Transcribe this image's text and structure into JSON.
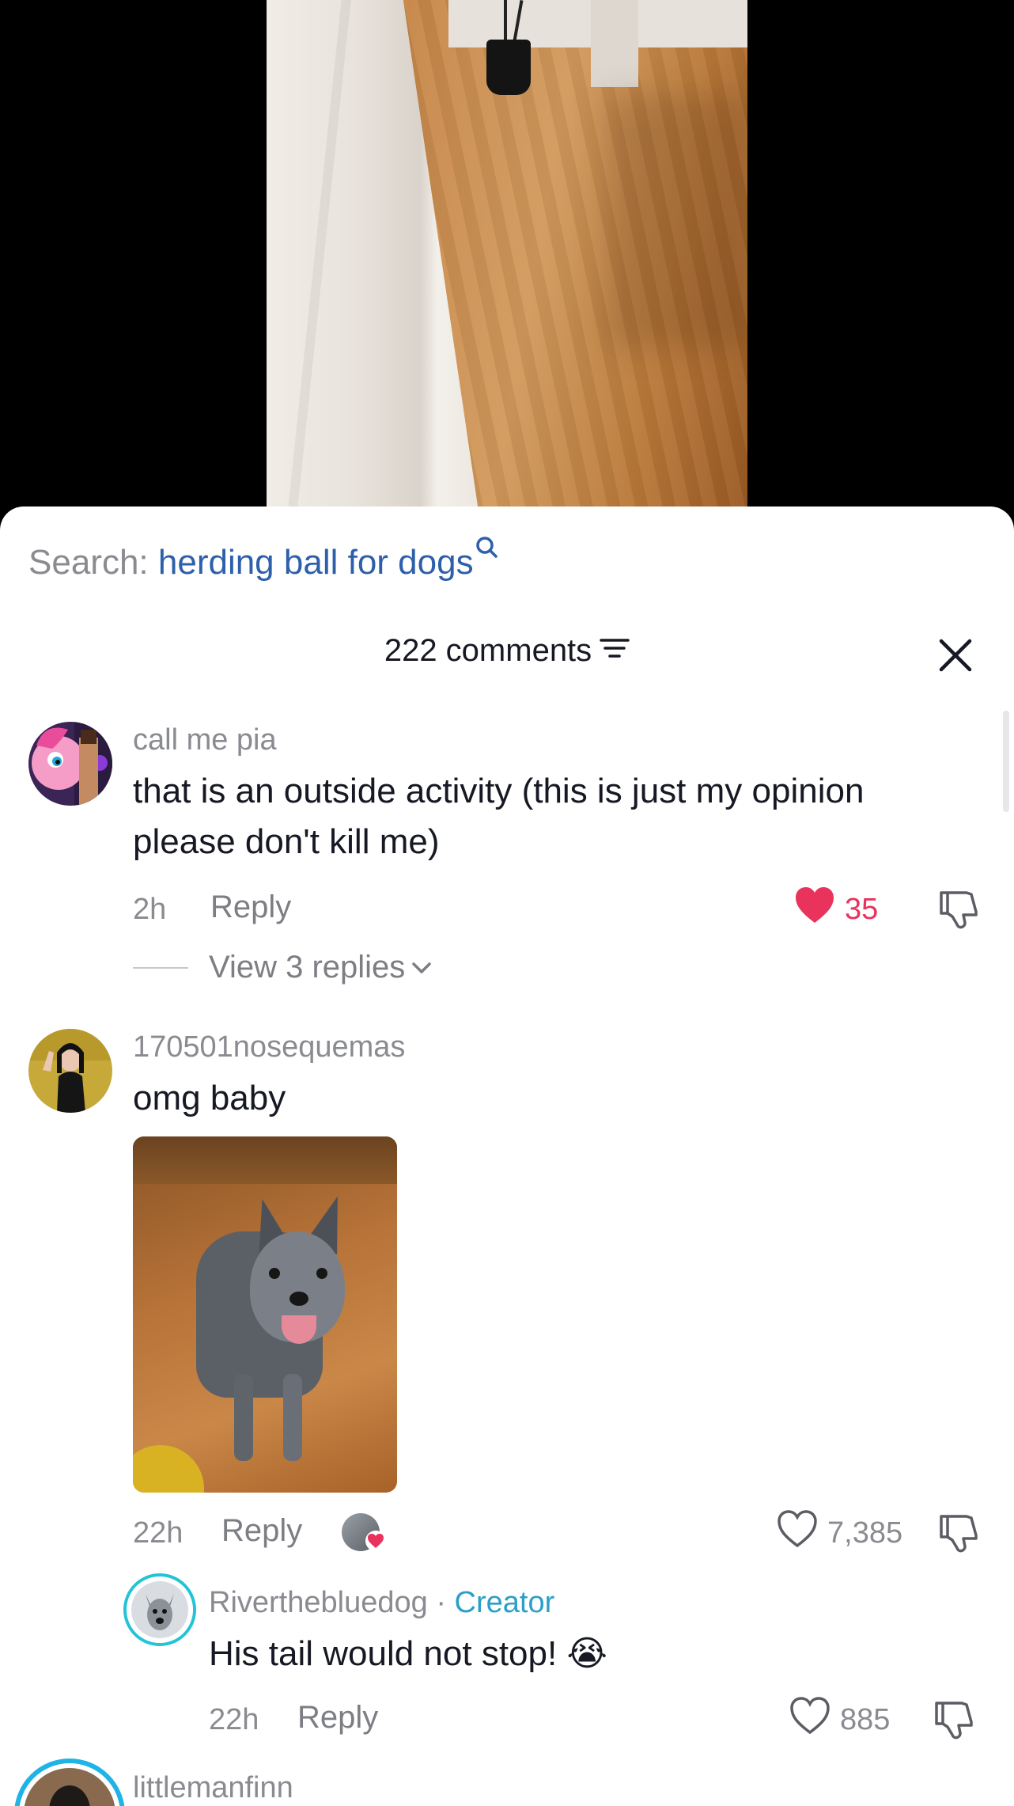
{
  "search": {
    "prefix": "Search:",
    "term": "herding ball for dogs"
  },
  "header": {
    "comment_count": "222 comments"
  },
  "comments": [
    {
      "username": "call me pia",
      "text": "that is an outside activity (this is just my opinion please don't kill me)",
      "time": "2h",
      "reply_label": "Reply",
      "likes": "35",
      "liked": true,
      "view_replies": "View 3 replies"
    },
    {
      "username": "170501nosequemas",
      "text": "omg baby",
      "time": "22h",
      "reply_label": "Reply",
      "likes": "7,385",
      "liked": false,
      "creator_liked": true
    }
  ],
  "reply": {
    "username": "Riverthebluedog",
    "separator": "·",
    "badge": "Creator",
    "text": "His tail would not stop! 😭",
    "time": "22h",
    "reply_label": "Reply",
    "likes": "885"
  },
  "next_comment": {
    "username": "littlemanfinn"
  },
  "colors": {
    "accent_red": "#e9335d",
    "search_blue": "#2d5fab",
    "creator_blue": "#2b9fc7"
  }
}
